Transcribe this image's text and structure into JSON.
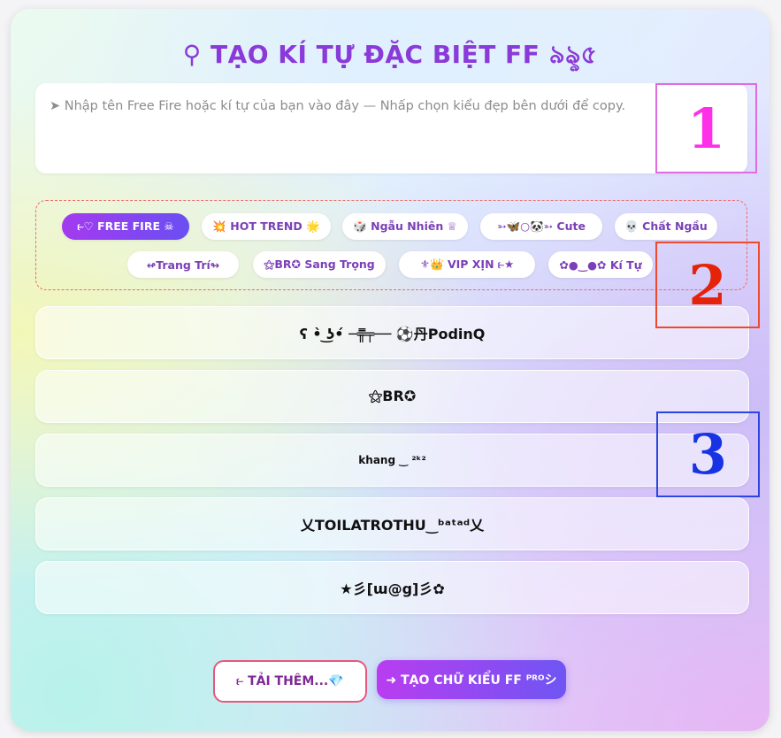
{
  "title": "⚲ TẠO KÍ TỰ ĐẶC BIỆT FF ৯ৡ৫",
  "input": {
    "placeholder": "➤ Nhập tên Free Fire hoặc kí tự của bạn vào đây — Nhấp chọn kiểu đẹp bên dưới để copy."
  },
  "annotations": [
    "1",
    "2",
    "3"
  ],
  "categories": [
    {
      "label": "⥼♡ FREE FIRE ☠",
      "active": true
    },
    {
      "label": "💥 HOT TREND 🌟",
      "active": false
    },
    {
      "label": "🎲 Ngẫu Nhiên ♕",
      "active": false
    },
    {
      "label": "➳🦋○🐼➳ Cute",
      "active": false
    },
    {
      "label": "💀 Chất Ngầu",
      "active": false
    },
    {
      "label": "↫Trang Trí↬",
      "active": false
    },
    {
      "label": "⚝BR✪ Sang Trọng",
      "active": false
    },
    {
      "label": "⚜👑 VIP XỊN ⥼★",
      "active": false
    },
    {
      "label": "✿●‿●✿ Kí Tự",
      "active": false
    }
  ],
  "results": [
    "ʕ •̀ ͜ʖ•́ ─╦̵̵̿╤── ⚽丹PodinQ",
    "⚝BR✪",
    "khang ‿ ²ᵏ²",
    "乂TOILATROTHU‿ᵇᵃᵗᵃᵈ乂",
    "★彡[ɯ@g]彡✿"
  ],
  "buttons": {
    "more": "⥼ TẢI THÊM...💎",
    "pro": "➜ TẠO CHỮ KIỂU FF ᴾᴿᴼシ"
  },
  "colors": {
    "title": "#8a3ad8",
    "accent": "#8b45f0",
    "annotation_1": "#ff2ee8",
    "annotation_2": "#e4230a",
    "annotation_3": "#1733e4"
  }
}
